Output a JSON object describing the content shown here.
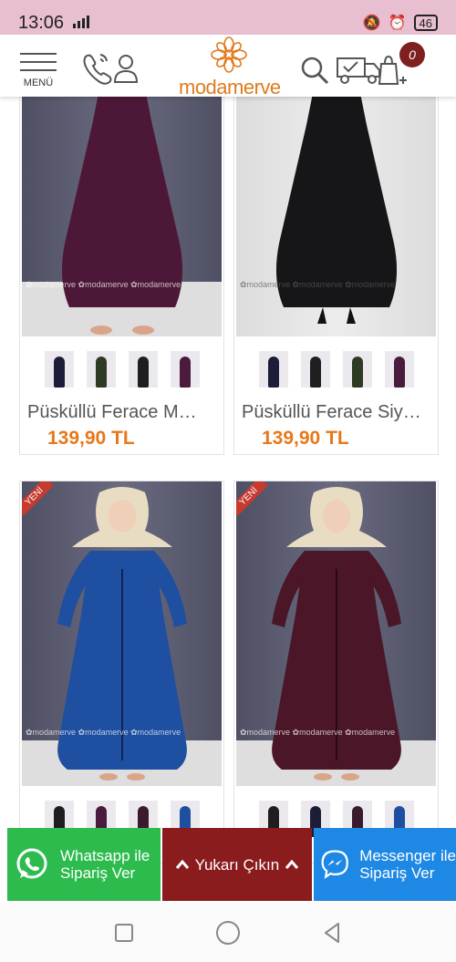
{
  "status_bar": {
    "time": "13:06",
    "network": "4G",
    "battery": "46"
  },
  "header": {
    "menu_label": "MENÜ",
    "logo_text": "modamerve",
    "cart_count": "0"
  },
  "products": [
    {
      "name": "Püsküllü Ferace M…",
      "price": "139,90 TL",
      "watermark": "✿modamerve ✿modamerve ✿modamerve",
      "dress_color": "#4d1837",
      "thumbs": [
        "#1d1d3a",
        "#2d3b22",
        "#1e1e1e",
        "#4a1b3c"
      ]
    },
    {
      "name": "Püsküllü Ferace Siy…",
      "price": "139,90 TL",
      "watermark": "✿modamerve ✿modamerve ✿modamerve",
      "dress_color": "#161618",
      "thumbs": [
        "#1d1d3a",
        "#1f1f1f",
        "#2d3b22",
        "#4a1b3c"
      ]
    },
    {
      "name": "",
      "price": "",
      "badge": "YENİ",
      "watermark": "✿modamerve ✿modamerve ✿modamerve",
      "dress_color": "#1f4fa0",
      "thumbs": [
        "#1e1e1e",
        "#4a1b3c",
        "#3b1a2e",
        "#1f4fa0"
      ]
    },
    {
      "name": "",
      "price": "",
      "badge": "YENİ",
      "watermark": "✿modamerve ✿modamerve ✿modamerve",
      "dress_color": "#4a1628",
      "thumbs": [
        "#1e1e1e",
        "#1d1d3a",
        "#3b1a2e",
        "#1f4fa0"
      ]
    }
  ],
  "actions": {
    "whatsapp_label_1": "Whatsapp ile",
    "whatsapp_label_2": "Sipariş Ver",
    "scroll_top_label": "Yukarı Çıkın",
    "messenger_label_1": "Messenger ile",
    "messenger_label_2": "Sipariş Ver"
  },
  "colors": {
    "accent": "#e7781a",
    "whatsapp": "#2dbb4e",
    "scroll_top": "#8b1c1e",
    "messenger": "#1e88e5",
    "status_bar": "#e8bfd0"
  }
}
